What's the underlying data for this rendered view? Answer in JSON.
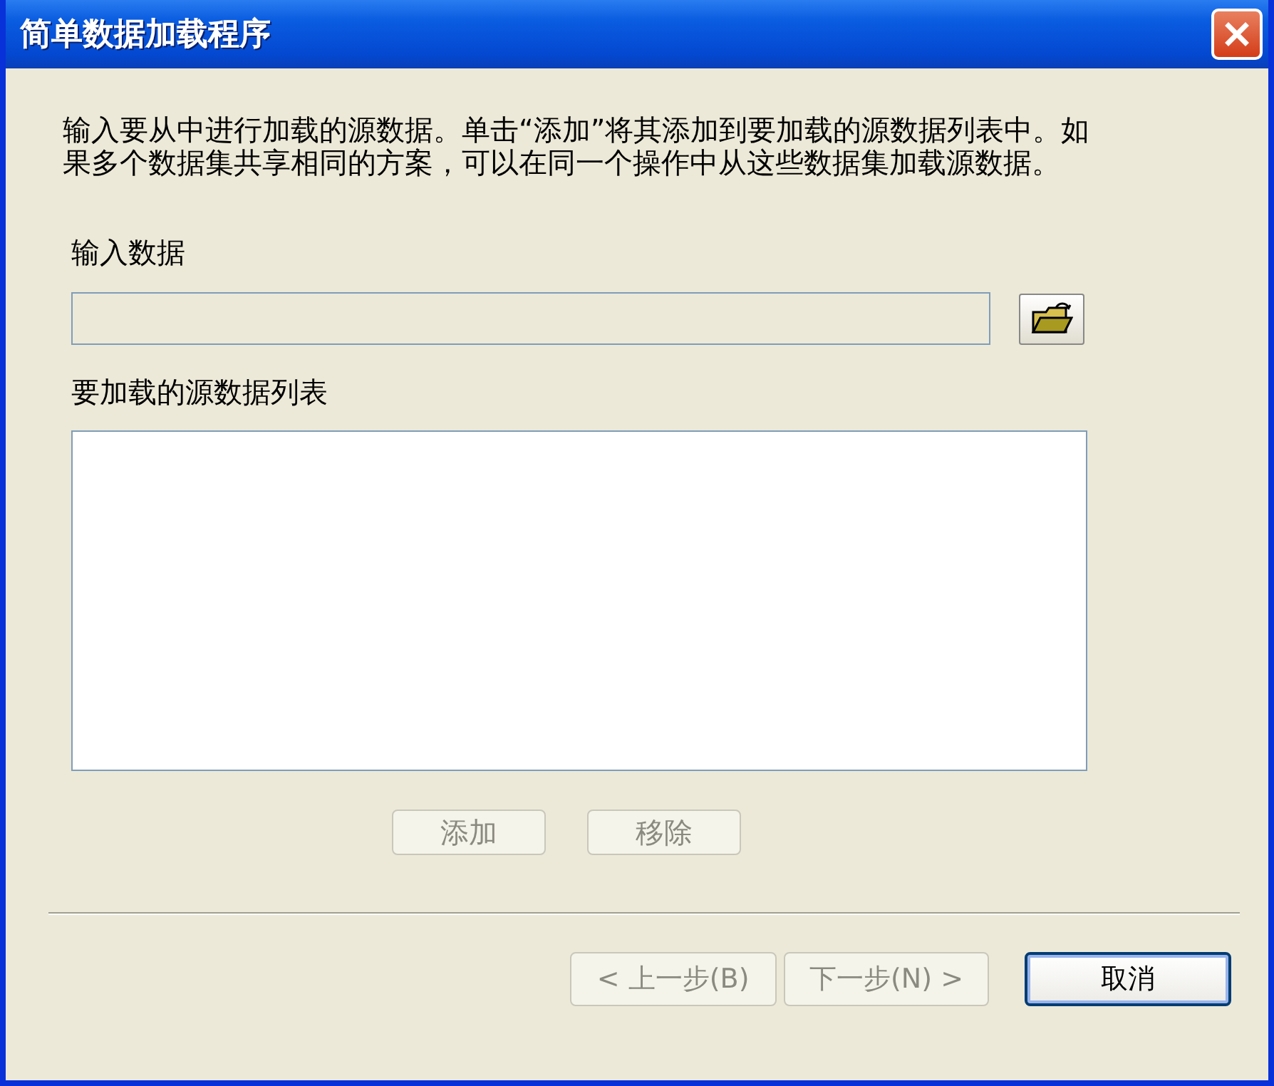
{
  "window": {
    "title": "简单数据加载程序"
  },
  "description": "输入要从中进行加载的源数据。单击“添加”将其添加到要加载的源数据列表中。如果多个数据集共享相同的方案，可以在同一个操作中从这些数据集加载源数据。",
  "input_data": {
    "label": "输入数据",
    "disabled": true
  },
  "source_list": {
    "label": "要加载的源数据列表"
  },
  "list_buttons": [
    {
      "label": "添加",
      "disabled": true
    },
    {
      "label": "移除",
      "disabled": true
    }
  ],
  "footer_buttons": [
    {
      "label": "< 上一步(B)",
      "disabled": true,
      "default": false
    },
    {
      "label": "下一步(N) >",
      "disabled": true,
      "default": false
    },
    {
      "label": "取消",
      "disabled": false,
      "default": true
    }
  ]
}
